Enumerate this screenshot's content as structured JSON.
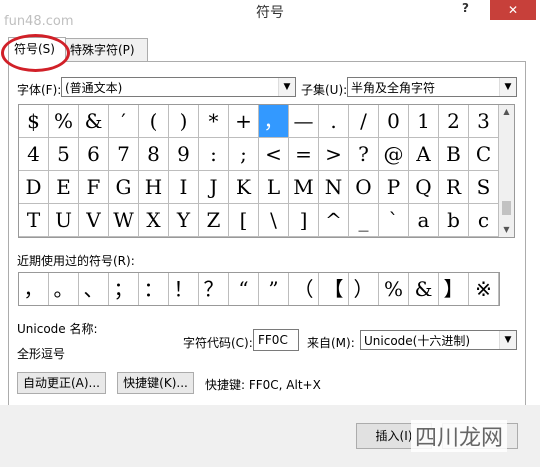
{
  "window": {
    "title": "符号",
    "help": "?",
    "close": "✕",
    "watermark_top": "fun48.com",
    "watermark_bottom": "四川龙网"
  },
  "tabs": [
    {
      "label": "符号(S)"
    },
    {
      "label": "特殊字符(P)"
    }
  ],
  "font": {
    "label": "字体(F):",
    "value": "(普通文本)"
  },
  "subset": {
    "label": "子集(U):",
    "value": "半角及全角字符"
  },
  "grid_rows": [
    [
      "$",
      "%",
      "&",
      "′",
      "(",
      ")",
      "*",
      "+",
      "，",
      "—",
      ".",
      "/",
      "0",
      "1",
      "2",
      "3"
    ],
    [
      "4",
      "5",
      "6",
      "7",
      "8",
      "9",
      ":",
      ";",
      "<",
      "=",
      ">",
      "?",
      "@",
      "A",
      "B",
      "C"
    ],
    [
      "D",
      "E",
      "F",
      "G",
      "H",
      "I",
      "J",
      "K",
      "L",
      "M",
      "N",
      "O",
      "P",
      "Q",
      "R",
      "S"
    ],
    [
      "T",
      "U",
      "V",
      "W",
      "X",
      "Y",
      "Z",
      "[",
      "\\",
      "]",
      "^",
      "_",
      "`",
      "a",
      "b",
      "c"
    ]
  ],
  "recent": {
    "label": "近期使用过的符号(R):",
    "symbols": [
      "，",
      "。",
      "、",
      "；",
      "：",
      "！",
      "？",
      "“",
      "”",
      "（",
      "【",
      "）",
      "%",
      "&",
      "】",
      "※"
    ]
  },
  "unicode_name": {
    "label": "Unicode 名称:",
    "value": "全形逗号"
  },
  "char_code": {
    "label": "字符代码(C):",
    "value": "FF0C"
  },
  "from": {
    "label": "来自(M):",
    "value": "Unicode(十六进制)"
  },
  "buttons": {
    "autocorrect": "自动更正(A)...",
    "shortcut": "快捷键(K)...",
    "insert": "插入(I)"
  },
  "shortcut_text": "快捷键: FF0C, Alt+X",
  "colors": {
    "selected": "#3399ff",
    "close": "#c7403a",
    "circle": "#d12028"
  }
}
